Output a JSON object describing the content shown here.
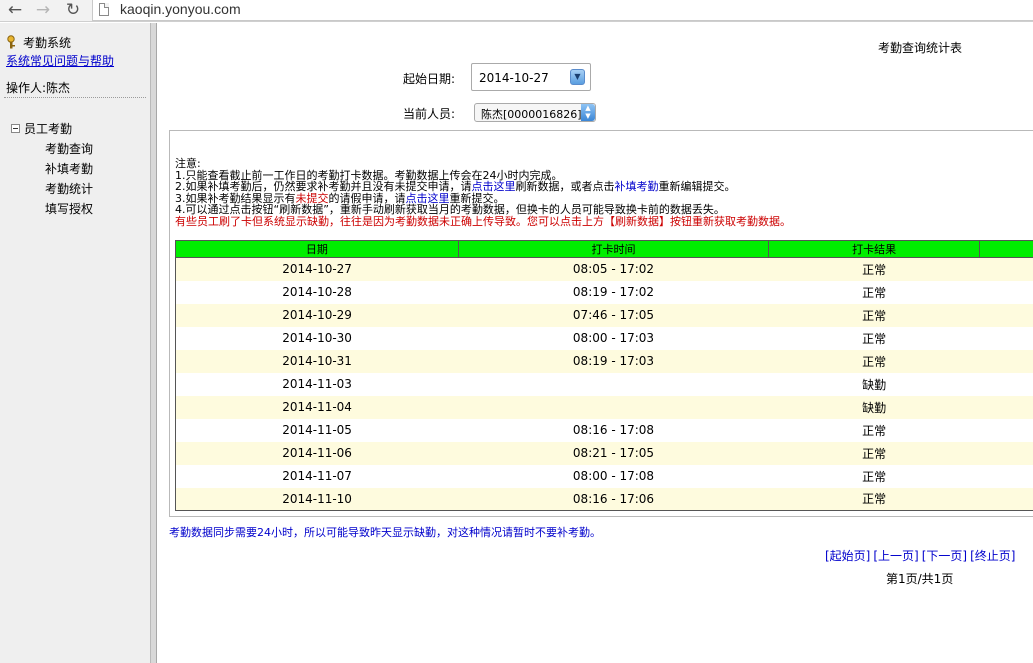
{
  "browser": {
    "url": "kaoqin.yonyou.com"
  },
  "sidebar": {
    "app_title": "考勤系统",
    "help_link": "系统常见问题与帮助",
    "operator": "操作人:陈杰",
    "tree_root": "员工考勤",
    "items": [
      {
        "label": "考勤查询"
      },
      {
        "label": "补填考勤"
      },
      {
        "label": "考勤统计"
      },
      {
        "label": "填写授权"
      }
    ]
  },
  "main": {
    "report_title": "考勤查询统计表",
    "start_date_label": "起始日期:",
    "start_date_value": "2014-10-27",
    "person_label": "当前人员:",
    "person_value": "陈杰[0000016826]",
    "notes": {
      "heading": "注意:",
      "line1": "1.只能查看截止前一工作日的考勤打卡数据。考勤数据上传会在24小时内完成。",
      "line2_a": "2.如果补填考勤后，仍然要求补考勤并且没有未提交申请，请",
      "line2_link1": "点击这里",
      "line2_b": "刷新数据，或者点击",
      "line2_link2": "补填考勤",
      "line2_c": "重新编辑提交。",
      "line3_a": "3.如果补考勤结果显示有",
      "line3_red": "未提交",
      "line3_b": "的请假申请，请",
      "line3_link": "点击这里",
      "line3_c": "重新提交。",
      "line4": "4.可以通过点击按钮“刷新数据”，重新手动刷新获取当月的考勤数据，但换卡的人员可能导致换卡前的数据丢失。",
      "line5": "有些员工刷了卡但系统显示缺勤，往往是因为考勤数据未正确上传导致。您可以点击上方【刷新数据】按钮重新获取考勤数据。"
    },
    "table": {
      "headers": [
        "日期",
        "打卡时间",
        "打卡结果"
      ],
      "rows": [
        {
          "date": "2014-10-27",
          "time": "08:05 - 17:02",
          "result": "正常"
        },
        {
          "date": "2014-10-28",
          "time": "08:19 - 17:02",
          "result": "正常"
        },
        {
          "date": "2014-10-29",
          "time": "07:46 - 17:05",
          "result": "正常"
        },
        {
          "date": "2014-10-30",
          "time": "08:00 - 17:03",
          "result": "正常"
        },
        {
          "date": "2014-10-31",
          "time": "08:19 - 17:03",
          "result": "正常"
        },
        {
          "date": "2014-11-03",
          "time": "",
          "result": "缺勤"
        },
        {
          "date": "2014-11-04",
          "time": "",
          "result": "缺勤"
        },
        {
          "date": "2014-11-05",
          "time": "08:16 - 17:08",
          "result": "正常"
        },
        {
          "date": "2014-11-06",
          "time": "08:21 - 17:05",
          "result": "正常"
        },
        {
          "date": "2014-11-07",
          "time": "08:00 - 17:08",
          "result": "正常"
        },
        {
          "date": "2014-11-10",
          "time": "08:16 - 17:06",
          "result": "正常"
        }
      ]
    },
    "footer_note": "考勤数据同步需要24小时，所以可能导致昨天显示缺勤，对这种情况请暂时不要补考勤。",
    "pager": {
      "first": "[起始页]",
      "prev": "[上一页]",
      "next": "[下一页]",
      "last": "[终止页]",
      "info": "第1页/共1页"
    }
  },
  "colors": {
    "table_header": "#00ee00",
    "row_highlight": "#fefbde",
    "link": "#0000cc",
    "warning": "#cc0000"
  }
}
